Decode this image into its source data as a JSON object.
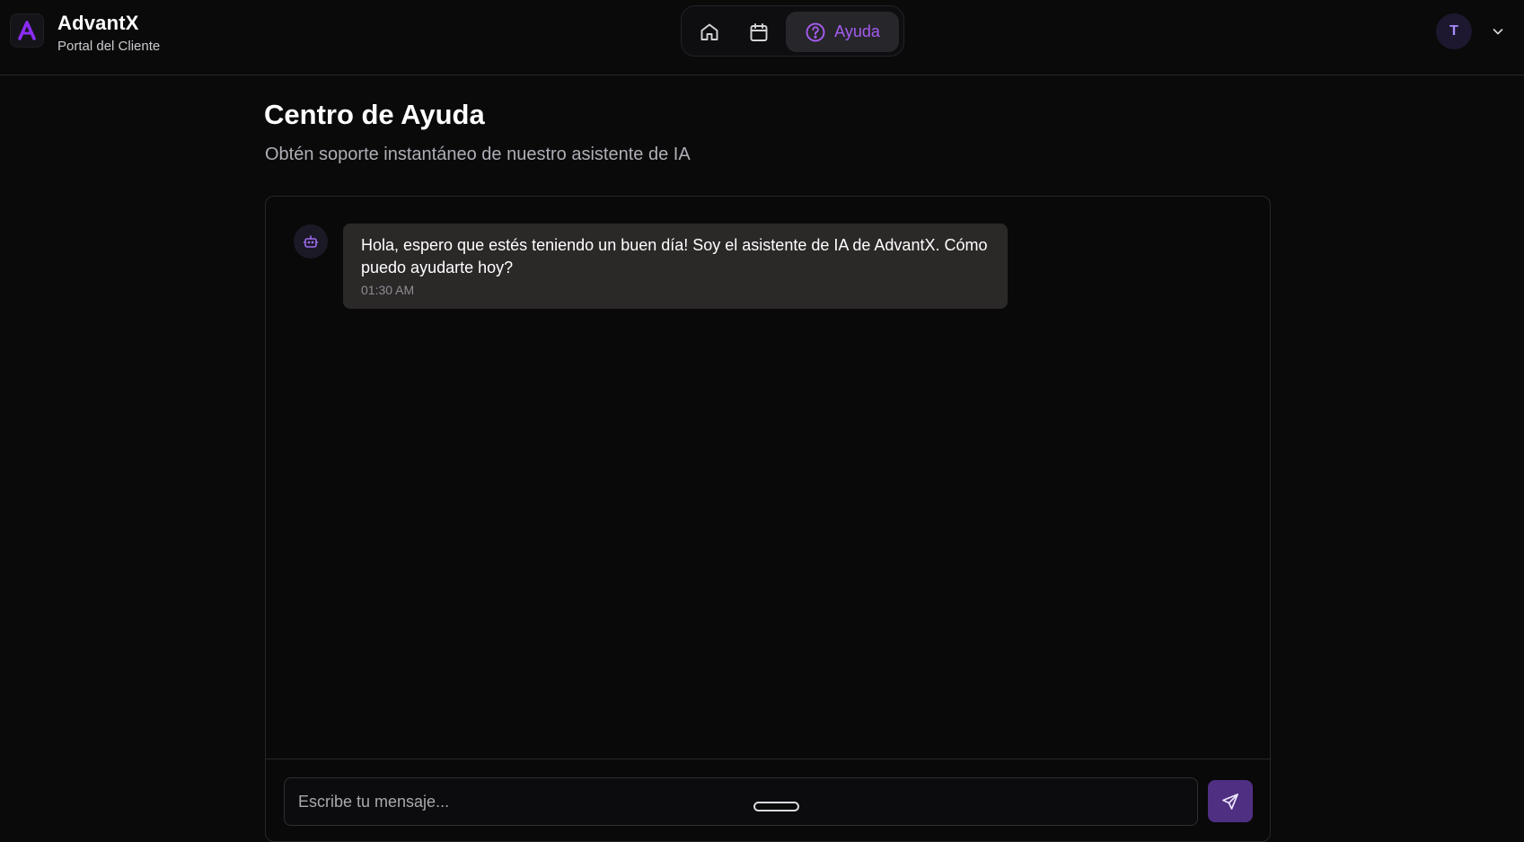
{
  "brand": {
    "name": "AdvantX",
    "subtitle": "Portal del Cliente",
    "logo_icon": "advantx-logo-icon"
  },
  "nav": {
    "items": [
      {
        "icon": "home-icon"
      },
      {
        "icon": "calendar-icon"
      },
      {
        "icon": "help-circle-icon",
        "label": "Ayuda",
        "active": true
      }
    ]
  },
  "user": {
    "avatar_initial": "T",
    "menu_icon": "chevron-down-icon"
  },
  "page": {
    "title": "Centro de Ayuda",
    "subtitle": "Obtén soporte instantáneo de nuestro asistente de IA"
  },
  "chat": {
    "messages": [
      {
        "sender": "bot",
        "icon": "bot-icon",
        "text": "Hola, espero que estés teniendo un buen día! Soy el asistente de IA de AdvantX. Cómo puedo ayudarte hoy?",
        "time": "01:30 AM"
      }
    ],
    "input": {
      "placeholder": "Escribe tu mensaje...",
      "value": ""
    },
    "send_icon": "send-icon"
  },
  "colors": {
    "background": "#0b0a0a",
    "accent": "#a55cf0",
    "send_button": "#4f2f82",
    "bubble": "#2b2828"
  }
}
